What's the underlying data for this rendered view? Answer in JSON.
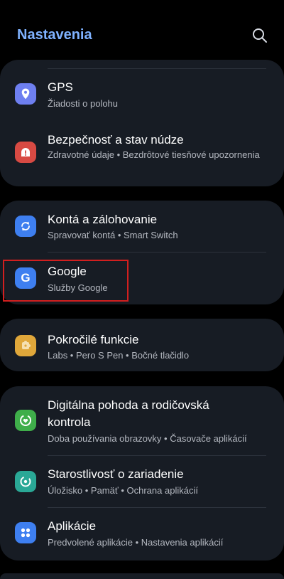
{
  "header": {
    "title": "Nastavenia"
  },
  "items": [
    {
      "title": "GPS",
      "subtitle": "Žiadosti o polohu",
      "icon": "location-icon",
      "color": "#6e7ff0"
    },
    {
      "title": "Bezpečnosť a stav núdze",
      "subtitle": "Zdravotné údaje • Bezdrôtové tiesňové upozornenia",
      "icon": "emergency-icon",
      "color": "#d84a43"
    },
    {
      "title": "Kontá a zálohovanie",
      "subtitle": "Spravovať kontá • Smart Switch",
      "icon": "sync-icon",
      "color": "#3e7ff0"
    },
    {
      "title": "Google",
      "subtitle": "Služby Google",
      "icon": "google-icon",
      "color": "#3e7ff0"
    },
    {
      "title": "Pokročilé funkcie",
      "subtitle": "Labs • Pero S Pen • Bočné tlačidlo",
      "icon": "puzzle-icon",
      "color": "#e0a73a"
    },
    {
      "title_line1": "Digitálna pohoda a rodičovská",
      "title_line2": "kontrola",
      "subtitle": "Doba používania obrazovky • Časovače aplikácií",
      "icon": "wellbeing-icon",
      "color": "#3fae4a"
    },
    {
      "title": "Starostlivosť o zariadenie",
      "subtitle": "Úložisko • Pamäť • Ochrana aplikácií",
      "icon": "device-care-icon",
      "color": "#2aa896"
    },
    {
      "title": "Aplikácie",
      "subtitle": "Predvolené aplikácie • Nastavenia aplikácií",
      "icon": "apps-icon",
      "color": "#3e7ff0"
    }
  ]
}
